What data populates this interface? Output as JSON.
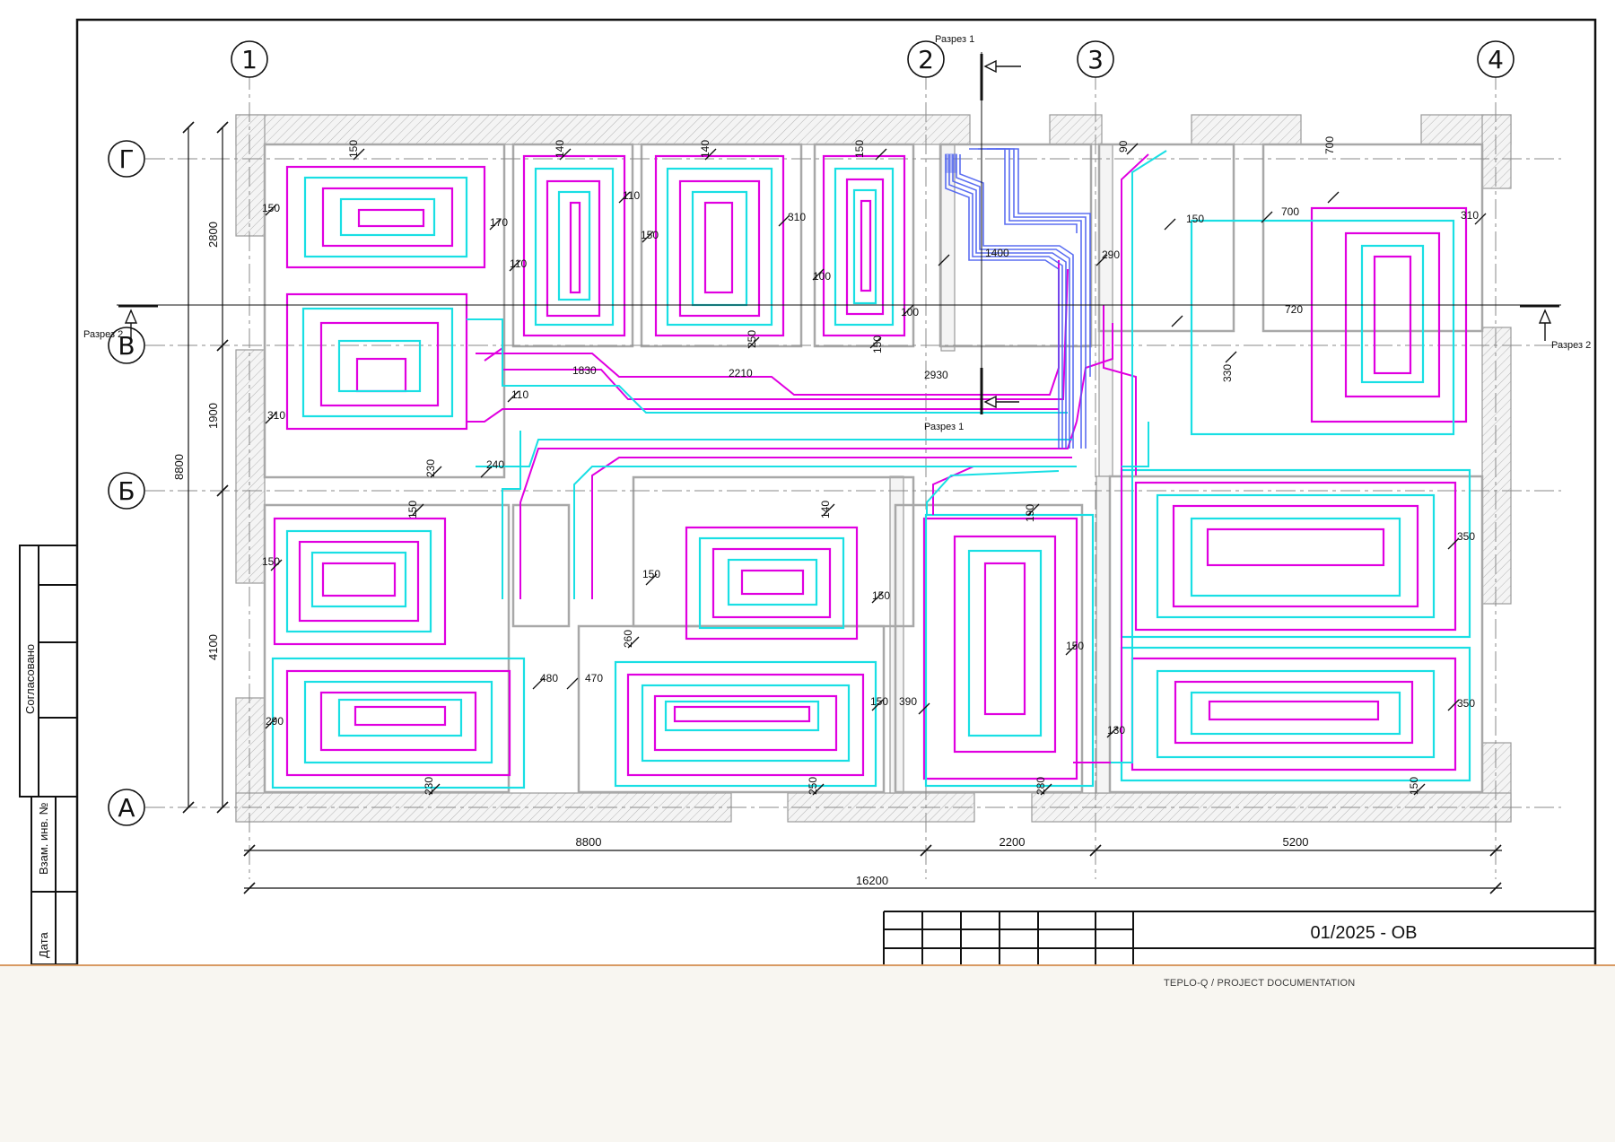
{
  "drawing_number": "01/2025 - ОВ",
  "footer_caption": "TEPLO-Q / PROJECT DOCUMENTATION",
  "colors": {
    "pipe_primary": "#e000e0",
    "pipe_secondary": "#19dfe4",
    "collector": "#4a5ff0",
    "wall_hatch": "#b5b5b5",
    "frame": "#111111",
    "page_accent": "#d89a62"
  },
  "axes": {
    "vertical": [
      "1",
      "2",
      "3",
      "4"
    ],
    "horizontal": [
      "Г",
      "В",
      "Б",
      "А"
    ]
  },
  "sections": {
    "section1_top": "Разрез 1",
    "section1_bottom": "Разрез 1",
    "section2_left": "Разрез 2",
    "section2_right": "Разрез 2"
  },
  "overall_dims": {
    "bays": [
      "8800",
      "2200",
      "5200"
    ],
    "total_x": "16200",
    "total_y": "8800",
    "rows": [
      "2800",
      "1900",
      "4100"
    ]
  },
  "stamp_labels": {
    "agreed": "Согласовано",
    "replace_inv": "Взам. инв. №",
    "date": "Дата"
  },
  "dims": {
    "d01": "150",
    "d02": "150",
    "d03": "170",
    "d04": "110",
    "d05": "140",
    "d06": "110",
    "d07": "150",
    "d08": "140",
    "d09": "310",
    "d10": "100",
    "d11": "250",
    "d12": "150",
    "d13": "100",
    "d14": "150",
    "d15": "1830",
    "d16": "2210",
    "d17": "2930",
    "d18": "1400",
    "d19": "290",
    "d20": "90",
    "d21": "150",
    "d22": "700",
    "d23": "700",
    "d24": "310",
    "d25": "720",
    "d26": "330",
    "d27": "310",
    "d28": "110",
    "d29": "230",
    "d30": "240",
    "d31": "150",
    "d32": "150",
    "d33": "140",
    "d34": "190",
    "d35": "150",
    "d36": "150",
    "d37": "260",
    "d38": "350",
    "d39": "290",
    "d40": "480",
    "d41": "470",
    "d42": "150",
    "d43": "390",
    "d44": "150",
    "d45": "350",
    "d46": "130",
    "d47": "230",
    "d48": "250",
    "d49": "280",
    "d50": "150"
  }
}
